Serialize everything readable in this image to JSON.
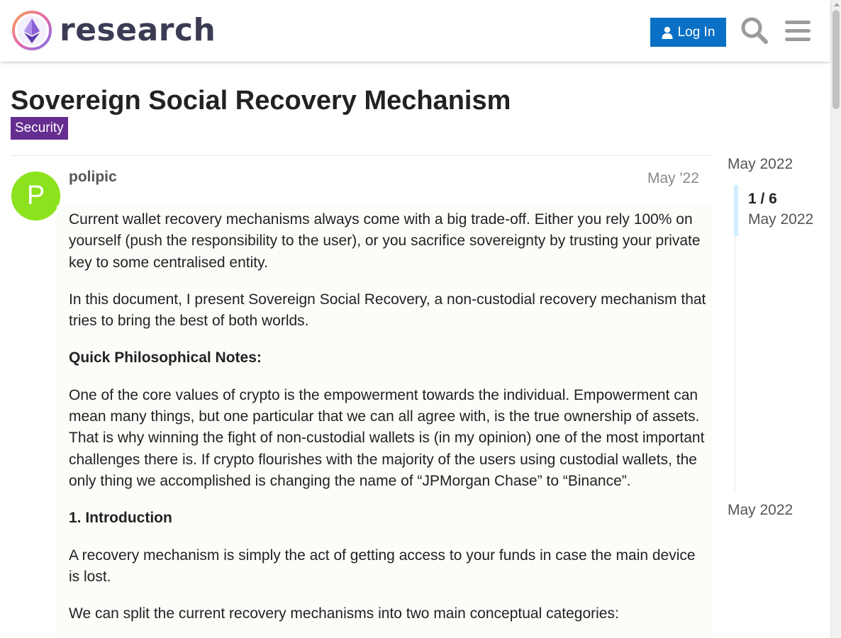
{
  "header": {
    "logo_text": "research",
    "login_label": "Log In",
    "search_icon": "search-icon",
    "menu_icon": "hamburger-menu-icon"
  },
  "topic": {
    "title": "Sovereign Social Recovery Mechanism",
    "category": "Security",
    "category_color": "#652d90"
  },
  "post": {
    "avatar_letter": "P",
    "avatar_color": "#8ce31d",
    "username": "polipic",
    "date": "May '22",
    "paragraphs": [
      "Current wallet recovery mechanisms always come with a big trade-off. Either you rely 100% on yourself (push the responsibility to the user), or you sacrifice sovereignty by trusting your private key to some centralised entity.",
      "In this document, I present Sovereign Social Recovery, a non-custodial recovery mechanism that tries to bring the best of both worlds.",
      "Quick Philosophical Notes:",
      "One of the core values of crypto is the empowerment towards the individual. Empowerment can mean many things, but one particular that we can all agree with, is the true ownership of assets. That is why winning the fight of non-custodial wallets is (in my opinion) one of the most important challenges there is. If crypto flourishes with the majority of the users using custodial wallets, the only thing we accomplished is changing the name of “JPMorgan Chase” to “Binance”.",
      "1. Introduction",
      "A recovery mechanism is simply the act of getting access to your funds in case the main device is lost.",
      "We can split the current recovery mechanisms into two main conceptual categories:"
    ]
  },
  "timeline": {
    "start_label": "May 2022",
    "position": "1 / 6",
    "position_date": "May 2022",
    "end_label": "May 2022"
  },
  "colors": {
    "accent": "#0a70c5",
    "timeline_handle": "#d1f0ff"
  }
}
